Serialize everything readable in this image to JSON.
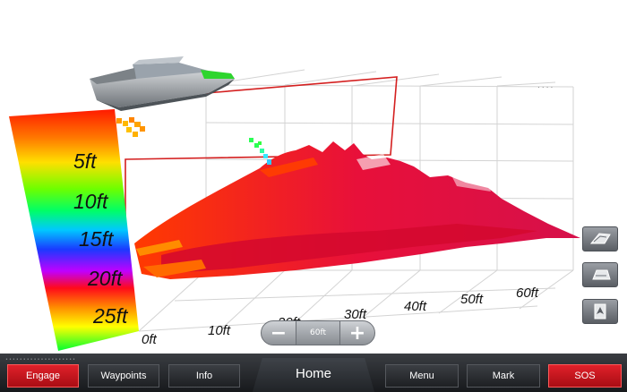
{
  "depth_scale": {
    "labels": [
      "5ft",
      "10ft",
      "15ft",
      "20ft",
      "25ft"
    ]
  },
  "distance_axis": {
    "labels": [
      "0ft",
      "10ft",
      "20ft",
      "30ft",
      "40ft",
      "50ft",
      "60ft"
    ]
  },
  "zoom": {
    "minus": "−",
    "range": "60ft",
    "plus": "+"
  },
  "view_buttons": [
    "view-perspective-icon",
    "view-top-icon",
    "view-forward-icon"
  ],
  "softkeys": {
    "engage": "Engage",
    "waypoints": "Waypoints",
    "info": "Info",
    "home": "Home",
    "menu": "Menu",
    "mark": "Mark",
    "sos": "SOS"
  },
  "colors": {
    "softkey_red": "#d0141c",
    "track": "#d42020",
    "bottom_bar": "#1f2124"
  }
}
